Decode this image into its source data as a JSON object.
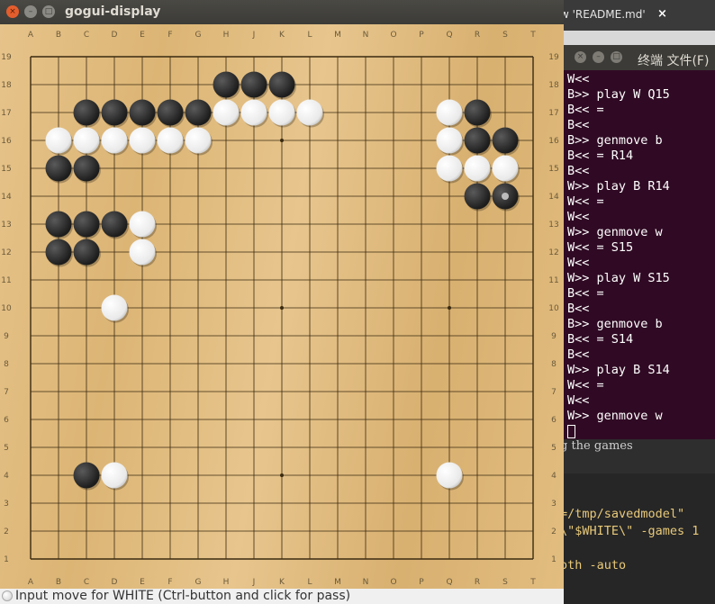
{
  "gogui": {
    "window_title": "gogui-display",
    "status_text": "Input move for WHITE (Ctrl-button and click for pass)",
    "board_size": 19,
    "columns": [
      "A",
      "B",
      "C",
      "D",
      "E",
      "F",
      "G",
      "H",
      "J",
      "K",
      "L",
      "M",
      "N",
      "O",
      "P",
      "Q",
      "R",
      "S",
      "T"
    ],
    "rows": [
      "19",
      "18",
      "17",
      "16",
      "15",
      "14",
      "13",
      "12",
      "11",
      "10",
      "9",
      "8",
      "7",
      "6",
      "5",
      "4",
      "3",
      "2",
      "1"
    ],
    "star_points": [
      "D16",
      "K16",
      "Q16",
      "D10",
      "K10",
      "Q10",
      "D4",
      "K4",
      "Q4"
    ],
    "black_stones": [
      "H18",
      "J18",
      "K18",
      "C17",
      "D17",
      "E17",
      "F17",
      "G17",
      "R17",
      "R16",
      "S16",
      "B15",
      "C15",
      "R14",
      "S14",
      "B13",
      "C13",
      "D13",
      "B12",
      "C12",
      "C4"
    ],
    "white_stones": [
      "H17",
      "J17",
      "K17",
      "L17",
      "Q17",
      "B16",
      "C16",
      "D16",
      "E16",
      "F16",
      "G16",
      "Q16",
      "Q15",
      "R15",
      "S15",
      "E13",
      "E12",
      "D10",
      "D4",
      "Q4"
    ],
    "last_move": "S14",
    "colors": {
      "black_stone": "#2b2b2b",
      "white_stone": "#f2f2f2",
      "grid_line": "#3a2a10",
      "label": "#6b5a3a"
    }
  },
  "editor": {
    "tab_label": "w 'README.md'",
    "tab_close": "×"
  },
  "terminal": {
    "title": "终端  文件(F)",
    "lines": [
      "W<<",
      "B>> play W Q15",
      "B<< =",
      "B<<",
      "B>> genmove b",
      "B<< = R14",
      "B<<",
      "W>> play B R14",
      "W<< =",
      "W<<",
      "W>> genmove w",
      "W<< = S15",
      "W<<",
      "W>> play W S15",
      "B<< =",
      "B<<",
      "B>> genmove b",
      "B<< = S14",
      "B<<",
      "W>> play B S14",
      "W<< =",
      "W<<",
      "W>> genmove w"
    ]
  },
  "doc": {
    "text": "g the games",
    "code_lines": [
      "=/tmp/savedmodel\"",
      "\\\"$WHITE\\\" -games 1",
      "oth -auto"
    ]
  }
}
